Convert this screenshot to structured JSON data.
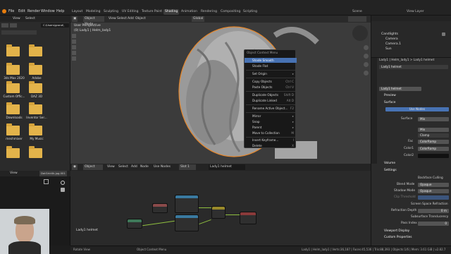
{
  "menubar": {
    "items": [
      "File",
      "Edit",
      "Render",
      "Window",
      "Help"
    ],
    "workspace_tabs": [
      "Layout",
      "Modeling",
      "Sculpting",
      "UV Editing",
      "Texture Paint",
      "Shading",
      "Animation",
      "Rendering",
      "Compositing",
      "Scripting"
    ],
    "active_tab": "Shading",
    "scene_label": "Scene",
    "view_layer_label": "View Layer"
  },
  "file_browser": {
    "header": [
      "View",
      "Select"
    ],
    "path": "C:\\Users\\grand\\",
    "folders": [
      "",
      "",
      "3ds Max 2020",
      "Adobe",
      "Custom Offic...",
      "DAZ 3D",
      "Downloads",
      "Inventor Ser...",
      "meshmixer",
      "My Music",
      "",
      ""
    ]
  },
  "viewport": {
    "mode": "Object Mode",
    "menus": [
      "View",
      "Select",
      "Add",
      "Object"
    ],
    "orientation_label": "Global",
    "info_line1": "User Perspective",
    "info_line2": "(0) Lady1 | Helm_lady1"
  },
  "context_menu": {
    "title": "Object Context Menu",
    "items": [
      {
        "label": "Shade Smooth",
        "shortcut": "",
        "highlight": true
      },
      {
        "label": "Shade Flat",
        "shortcut": "",
        "highlight": false
      },
      {
        "label": "Set Origin",
        "shortcut": "▸",
        "highlight": false
      },
      {
        "label": "Copy Objects",
        "shortcut": "Ctrl C",
        "highlight": false
      },
      {
        "label": "Paste Objects",
        "shortcut": "Ctrl V",
        "highlight": false
      },
      {
        "label": "Duplicate Objects",
        "shortcut": "Shift D",
        "highlight": false
      },
      {
        "label": "Duplicate Linked",
        "shortcut": "Alt D",
        "highlight": false
      },
      {
        "label": "Rename Active Object...",
        "shortcut": "F2",
        "highlight": false
      },
      {
        "label": "Mirror",
        "shortcut": "▸",
        "highlight": false
      },
      {
        "label": "Snap",
        "shortcut": "▸",
        "highlight": false
      },
      {
        "label": "Parent",
        "shortcut": "▸",
        "highlight": false
      },
      {
        "label": "Move to Collection",
        "shortcut": "M",
        "highlight": false
      },
      {
        "label": "Insert Keyframe...",
        "shortcut": "I",
        "highlight": false
      },
      {
        "label": "Delete",
        "shortcut": "X",
        "highlight": false
      }
    ]
  },
  "node_editor": {
    "header": [
      "Object",
      "View",
      "Select",
      "Add",
      "Node"
    ],
    "use_nodes_label": "Use Nodes",
    "slot_label": "Slot 1",
    "material_label": "Lady1 helmet",
    "object_label": "Lady1 helmet"
  },
  "image_editor": {
    "header": [
      "View"
    ],
    "image_name": "DotGrid4k.jpg.001"
  },
  "outliner": {
    "items": [
      "Candlights",
      "Camera",
      "Camera.1",
      "Sun"
    ]
  },
  "properties": {
    "breadcrumb": "Lady1 | Helm_lady1  >  Lady1 helmet",
    "material_slot": "Lady1 helmet",
    "material_name": "Lady1 helmet",
    "sections": {
      "preview": "Preview",
      "surface": "Surface",
      "volume": "Volume",
      "settings": "Settings",
      "viewport_display": "Viewport Display",
      "custom_properties": "Custom Properties"
    },
    "use_nodes_button": "Use Nodes",
    "rows": [
      {
        "label": "Surface",
        "value": "Mix"
      },
      {
        "label": "",
        "value": "Mix"
      },
      {
        "label": "",
        "value": "Clamp"
      },
      {
        "label": "Fac",
        "value": "ColorRamp"
      },
      {
        "label": "Color1",
        "value": "ColorRamp"
      },
      {
        "label": "Color2",
        "value": ""
      }
    ],
    "settings_rows": [
      {
        "label": "",
        "value": "Backface Culling"
      },
      {
        "label": "Blend Mode",
        "value": "Opaque"
      },
      {
        "label": "Shadow Mode",
        "value": "Opaque"
      },
      {
        "label": "Clip Threshold",
        "value": ""
      },
      {
        "label": "",
        "value": "Screen Space Refraction"
      },
      {
        "label": "Refraction Depth",
        "value": "0 m"
      },
      {
        "label": "",
        "value": "Subsurface Translucency"
      },
      {
        "label": "Pass Index",
        "value": "0"
      }
    ]
  },
  "statusbar": {
    "left": "Rotate View",
    "middle": "Object Context Menu",
    "right": "Lady1 | Helm_lady1 | Verts:36,187 | Faces:45,536 | Tris:88,393 | Objects:1/6 | Mem: 3.61 GiB | v2.82.7"
  },
  "colors": {
    "accent": "#4772b3",
    "folder": "#e3b34a",
    "selection_outline": "#e5872c"
  }
}
